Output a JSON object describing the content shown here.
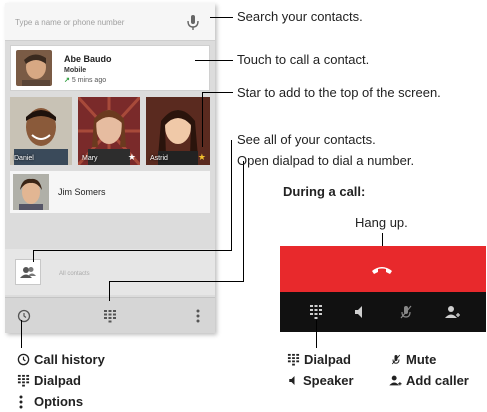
{
  "search": {
    "placeholder": "Type a name or phone number"
  },
  "recent": {
    "name": "Abe Baudo",
    "type": "Mobile",
    "time": "5 mins ago"
  },
  "favorites": [
    {
      "label": "Daniel",
      "star": ""
    },
    {
      "label": "Mary",
      "star": "★"
    },
    {
      "label": "Astrid",
      "star": "★"
    }
  ],
  "contact": {
    "name": "Jim Somers"
  },
  "all_contacts_label": "All contacts",
  "callouts": {
    "search": "Search your contacts.",
    "touch": "Touch to call a contact.",
    "star": "Star to add to the top of the screen.",
    "see_all": "See all of your contacts.",
    "open_dialpad": "Open dialpad to dial a number."
  },
  "call": {
    "heading": "During a call:",
    "hang_up": "Hang up."
  },
  "legend": {
    "call_history": "Call history",
    "dialpad": "Dialpad",
    "options": "Options",
    "dialpad_call": "Dialpad",
    "speaker": "Speaker",
    "mute": "Mute",
    "add_caller": "Add caller"
  },
  "colors": {
    "red_bar": "#e8292c",
    "recent_arrow": "#2e9e3e",
    "star_gold": "#f2c12e"
  }
}
